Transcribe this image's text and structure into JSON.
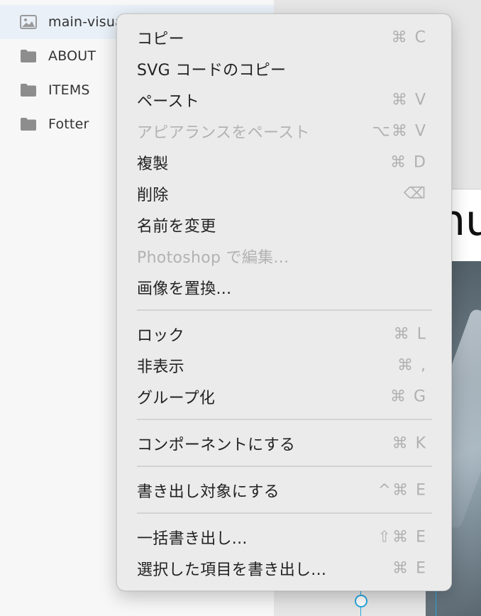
{
  "layers": [
    {
      "label": "main-visua",
      "icon": "image-icon",
      "selected": true
    },
    {
      "label": "ABOUT",
      "icon": "folder-icon"
    },
    {
      "label": "ITEMS",
      "icon": "folder-icon"
    },
    {
      "label": "Fotter",
      "icon": "folder-icon"
    }
  ],
  "canvas": {
    "artboard_text": "nu"
  },
  "menu": {
    "copy": {
      "label": "コピー",
      "shortcut": "⌘ C"
    },
    "copy_svg": {
      "label": "SVG コードのコピー",
      "shortcut": ""
    },
    "paste": {
      "label": "ペースト",
      "shortcut": "⌘ V"
    },
    "paste_appearance": {
      "label": "アピアランスをペースト",
      "shortcut": "⌥⌘ V",
      "disabled": true
    },
    "duplicate": {
      "label": "複製",
      "shortcut": "⌘ D"
    },
    "delete": {
      "label": "削除",
      "shortcut": "⌫"
    },
    "rename": {
      "label": "名前を変更",
      "shortcut": ""
    },
    "edit_photoshop": {
      "label": "Photoshop で編集...",
      "shortcut": "",
      "disabled": true
    },
    "replace_image": {
      "label": "画像を置換...",
      "shortcut": ""
    },
    "lock": {
      "label": "ロック",
      "shortcut": "⌘ L"
    },
    "hide": {
      "label": "非表示",
      "shortcut": "⌘ ,"
    },
    "group": {
      "label": "グループ化",
      "shortcut": "⌘ G"
    },
    "make_component": {
      "label": "コンポーネントにする",
      "shortcut": "⌘ K"
    },
    "mark_export": {
      "label": "書き出し対象にする",
      "shortcut": "^⌘ E"
    },
    "batch_export": {
      "label": "一括書き出し...",
      "shortcut": "⇧⌘ E"
    },
    "export_selected": {
      "label": "選択した項目を書き出し...",
      "shortcut": "⌘ E"
    }
  },
  "colors": {
    "selection": "#29a8e0",
    "menu_bg": "#ebebeb",
    "disabled_text": "#b2b2b2"
  }
}
